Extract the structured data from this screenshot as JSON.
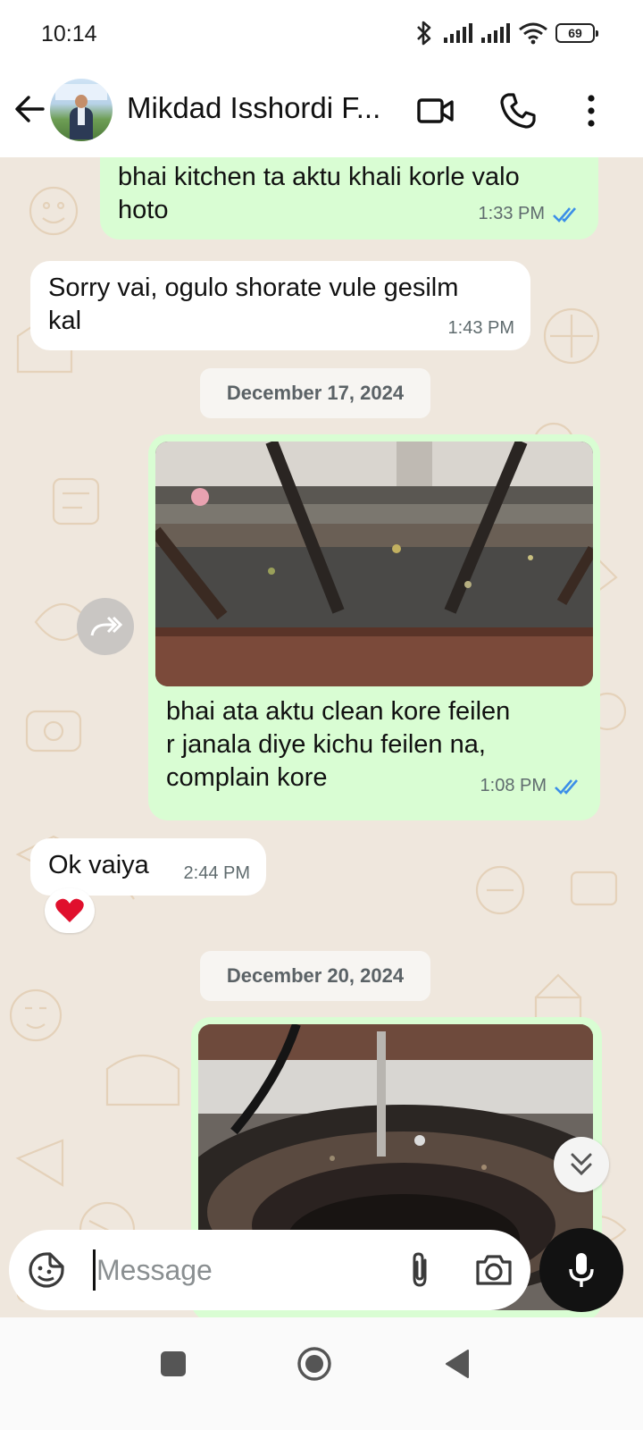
{
  "status_bar": {
    "time": "10:14",
    "battery": "69",
    "icons": [
      "bluetooth-icon",
      "signal-icon",
      "signal-icon",
      "wifi-icon",
      "battery-icon"
    ]
  },
  "header": {
    "title": "Mikdad Isshordi F...",
    "icons": [
      "back-arrow-icon",
      "video-call-icon",
      "phone-icon",
      "more-options-icon"
    ]
  },
  "messages": [
    {
      "direction": "out",
      "text": "bhai kitchen ta aktu khali korle valo hoto",
      "time": "1:33 PM",
      "status": "read"
    },
    {
      "direction": "in",
      "text": "Sorry vai, ogulo shorate vule gesilm kal",
      "time": "1:43 PM"
    },
    {
      "date": "December 17, 2024"
    },
    {
      "direction": "out",
      "type": "image",
      "caption": "bhai ata aktu clean kore feilen r janala diye kichu feilen na, complain kore",
      "time": "1:08 PM",
      "status": "read"
    },
    {
      "direction": "in",
      "text": "Ok vaiya",
      "time": "2:44 PM",
      "reaction": "red-heart"
    },
    {
      "date": "December 20, 2024"
    },
    {
      "direction": "out",
      "type": "image"
    }
  ],
  "msg1_line1": "bhai kitchen ta aktu khali korle valo",
  "msg1_line2": "hoto",
  "msg2_line1": "Sorry vai, ogulo shorate vule gesilm",
  "msg2_line2": "kal",
  "caption_line1": "bhai ata aktu clean kore feilen",
  "caption_line2": "r janala diye kichu feilen na,",
  "caption_line3": "complain kore",
  "composer": {
    "placeholder": "Message",
    "value": ""
  },
  "colors": {
    "outgoing_bubble": "#d9fdd3",
    "incoming_bubble": "#ffffff",
    "chat_background": "#efe7dd",
    "read_ticks": "#53bdeb",
    "reaction_heart": "#e0102d"
  }
}
